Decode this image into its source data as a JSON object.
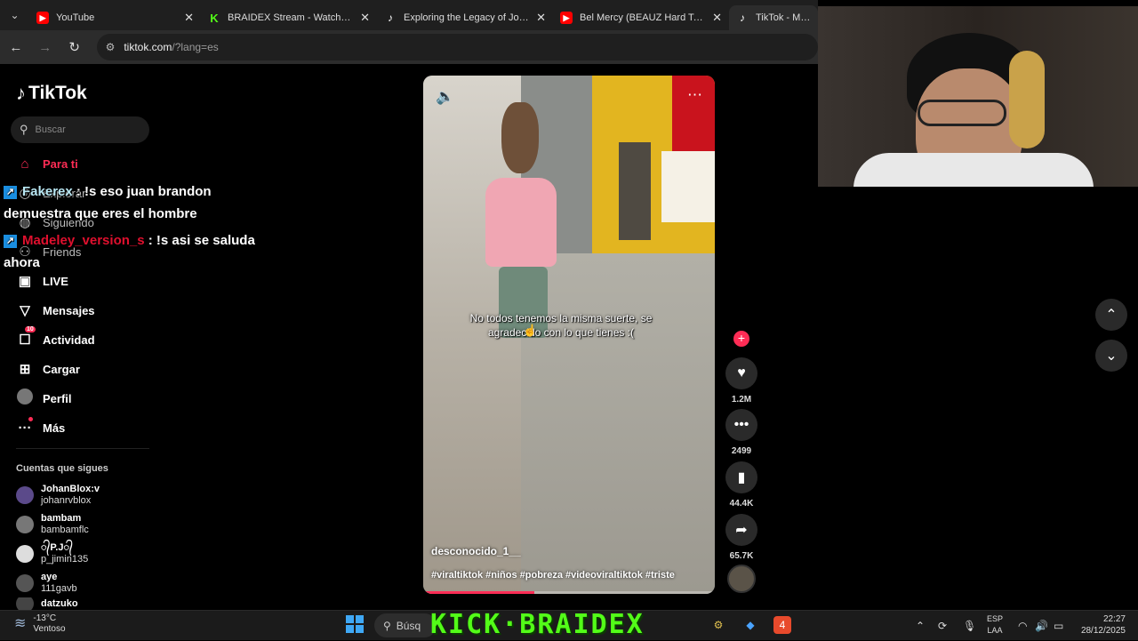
{
  "browser": {
    "tabs": [
      {
        "title": "YouTube",
        "favicon": "youtube-icon"
      },
      {
        "title": "BRAIDEX Stream - Watch Live o",
        "favicon": "kick-icon"
      },
      {
        "title": "Exploring the Legacy of José Jo",
        "favicon": "tiktok-icon"
      },
      {
        "title": "Bel Mercy (BEAUZ Hard Techno",
        "favicon": "youtube-icon"
      },
      {
        "title": "TikTok - Make Y",
        "favicon": "tiktok-icon",
        "active": true
      }
    ],
    "url_host": "tiktok.com",
    "url_path": "/?lang=es"
  },
  "tiktok": {
    "logo_text": "TikTok",
    "search_placeholder": "Buscar",
    "nav": [
      {
        "label": "Para ti",
        "icon": "home-icon",
        "active": true
      },
      {
        "label": "Explorar",
        "icon": "compass-icon"
      },
      {
        "label": "Siguiendo",
        "icon": "following-icon"
      },
      {
        "label": "Friends",
        "icon": "friends-icon"
      },
      {
        "label": "LIVE",
        "icon": "live-icon"
      },
      {
        "label": "Mensajes",
        "icon": "messages-icon"
      },
      {
        "label": "Actividad",
        "icon": "activity-icon",
        "badge": "10"
      },
      {
        "label": "Cargar",
        "icon": "upload-icon"
      },
      {
        "label": "Perfil",
        "icon": "profile-avatar"
      },
      {
        "label": "Más",
        "icon": "more-icon"
      }
    ],
    "following_title": "Cuentas que sigues",
    "following": [
      {
        "name": "JohanBlox:v",
        "user": "johanrvblox"
      },
      {
        "name": "bambam",
        "user": "bambamflc"
      },
      {
        "name": "᭄P.J᭄",
        "user": "p_jimin135"
      },
      {
        "name": "aye",
        "user": "111gavb"
      },
      {
        "name": "datzuko",
        "user": ""
      }
    ],
    "video": {
      "caption": "No todos tenemos la misma suerte, se agradecido con lo que tienes :(",
      "author": "desconocido_1__",
      "tags": "#viraltiktok #niños #pobreza #videoviraltiktok #triste",
      "progress": 0.38
    },
    "actions": {
      "likes": "1.2M",
      "comments": "2499",
      "saves": "44.4K",
      "shares": "65.7K"
    }
  },
  "chat": [
    {
      "user": "Fakerex",
      "message": ": !s eso juan brandon demuestra que eres el hombre"
    },
    {
      "user": "Madeley_version_s",
      "message": ": !s asi se saluda ahora"
    }
  ],
  "taskbar": {
    "temperature": "-13°C",
    "weather_desc": "Ventoso",
    "search_label": "Búsq",
    "banner": "KICK·BRAIDEX",
    "lang_line1": "ESP",
    "lang_line2": "LAA",
    "time": "22:27",
    "date": "28/12/2025"
  },
  "colors": {
    "tiktok_red": "#fe2c55",
    "kick_green": "#53fc18"
  }
}
